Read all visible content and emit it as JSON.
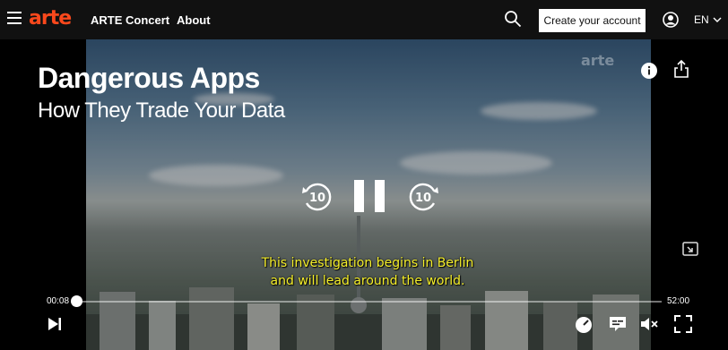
{
  "header": {
    "logo": "arte",
    "nav": [
      "ARTE Concert",
      "About"
    ],
    "account_button": "Create your account",
    "language": "EN"
  },
  "player": {
    "title": "Dangerous Apps",
    "subtitle": "How They Trade Your Data",
    "watermark": "arte",
    "rewind_seconds": "10",
    "forward_seconds": "10",
    "caption_line1": "This investigation begins in Berlin",
    "caption_line2": "and will lead around the world.",
    "current_time": "00:08",
    "total_time": "52:00",
    "progress": 0.0026
  },
  "colors": {
    "brand": "#fa481c",
    "caption": "#f5ef2a"
  },
  "icons": [
    "menu-icon",
    "search-icon",
    "user-icon",
    "chevron-down-icon",
    "info-icon",
    "share-icon",
    "rewind-10-icon",
    "pause-icon",
    "forward-10-icon",
    "pip-icon",
    "next-icon",
    "speed-icon",
    "subtitles-icon",
    "mute-icon",
    "fullscreen-icon"
  ]
}
